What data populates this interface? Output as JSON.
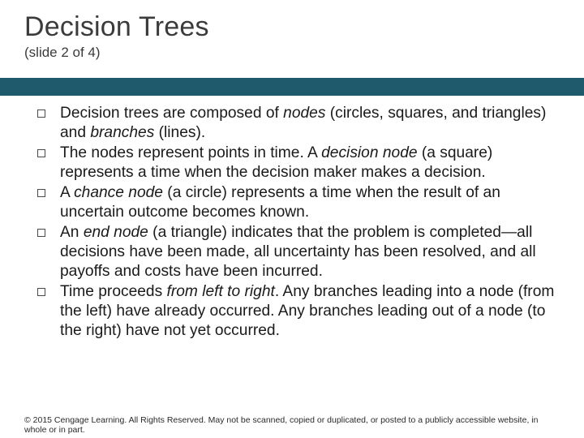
{
  "title": "Decision Trees",
  "subtitle": "(slide 2 of 4)",
  "bullets": [
    {
      "pre": "Decision trees are composed of ",
      "i1": "nodes",
      "mid1": " (circles, squares, and triangles) and ",
      "i2": "branches",
      "post": " (lines)."
    },
    {
      "pre": "The nodes represent points in time. A ",
      "i1": "decision node",
      "mid1": " (a square) represents a time when the decision maker makes a decision.",
      "i2": "",
      "post": ""
    },
    {
      "pre": "A ",
      "i1": "chance node",
      "mid1": " (a circle) represents a time when the result of an uncertain outcome becomes known.",
      "i2": "",
      "post": ""
    },
    {
      "pre": "An ",
      "i1": "end node",
      "mid1": " (a triangle) indicates that the problem is completed—all decisions have been made, all uncertainty has been resolved, and all payoffs and costs have been incurred.",
      "i2": "",
      "post": ""
    },
    {
      "pre": "Time proceeds ",
      "i1": "from left to right",
      "mid1": ". Any branches leading into a node (from the left) have already occurred. Any branches leading out of a node (to the right) have not yet occurred.",
      "i2": "",
      "post": ""
    }
  ],
  "footer": "© 2015 Cengage Learning. All Rights Reserved. May not be scanned, copied or duplicated, or posted to a publicly accessible website, in whole or in part."
}
